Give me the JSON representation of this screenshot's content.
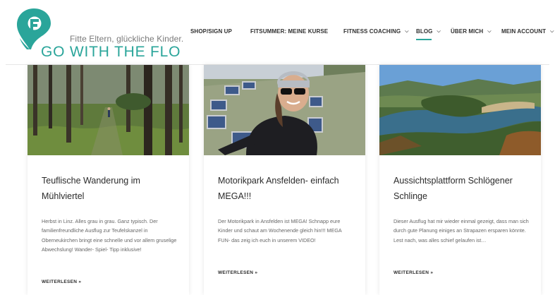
{
  "brand": {
    "tagline": "Fitte Eltern, glückliche Kinder.",
    "name": "GO WITH THE FLO",
    "color": "#2aa59a"
  },
  "nav": {
    "items": [
      {
        "label": "SHOP/SIGN UP",
        "has_dropdown": false
      },
      {
        "label": "FITSUMMER: MEINE KURSE",
        "has_dropdown": false
      },
      {
        "label": "FITNESS COACHING",
        "has_dropdown": true
      },
      {
        "label": "BLOG",
        "has_dropdown": true,
        "active": true
      },
      {
        "label": "ÜBER MICH",
        "has_dropdown": true
      },
      {
        "label": "MEIN ACCOUNT",
        "has_dropdown": true
      }
    ],
    "dropdown_icon": "chevron-down-icon"
  },
  "posts": [
    {
      "title": "Teuflische Wanderung im Mühlviertel",
      "excerpt": "Herbst in Linz. Alles grau in grau. Ganz typisch. Der familienfreundliche Ausflug zur Teufelskanzel in Oberneukirchen bringt eine schnelle und vor allem gruselige Abwechslung! Wander- Spiel- Tipp inklusive!",
      "read_more": "WEITERLESEN »",
      "image": "forest-path-photo"
    },
    {
      "title": "Motorikpark Ansfelden- einfach MEGA!!!",
      "excerpt": "Der Motorikpark in Ansfelden ist MEGA! Schnapp eure Kinder und schaut am Wochenende gleich hin!!! MEGA FUN- das zeig ich euch in unserem VIDEO!",
      "read_more": "WEITERLESEN »",
      "image": "selfie-motorikpark-photo"
    },
    {
      "title": "Aussichtsplattform Schlögener Schlinge",
      "excerpt": "Dieser Ausflug hat mir wieder einmal gezeigt, dass man sich durch gute Planung einiges an Strapazen ersparen könnte. Lest nach, was alles schief gelaufen ist…",
      "read_more": "WEITERLESEN »",
      "image": "river-bend-photo"
    }
  ]
}
